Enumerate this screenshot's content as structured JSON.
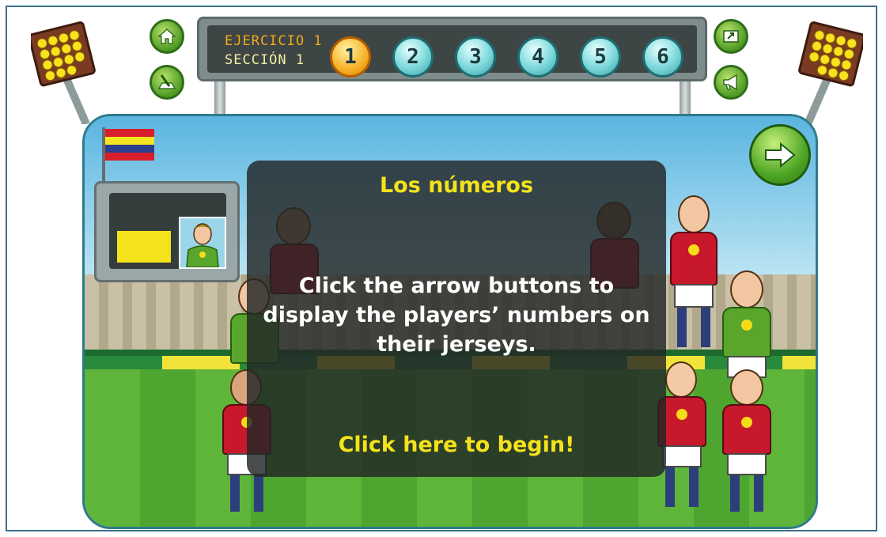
{
  "header": {
    "exercise_label": "EJERCICIO 1",
    "section_label": "SECCIÓN 1",
    "current_number": "1",
    "numbers": [
      "1",
      "2",
      "3",
      "4",
      "5",
      "6"
    ]
  },
  "icons": {
    "home": "home-icon",
    "pencil": "pencil-icon",
    "fullscreen": "fullscreen-icon",
    "sound": "megaphone-icon",
    "next": "arrow-right-icon"
  },
  "overlay": {
    "title": "Los números",
    "instructions": "Click the arrow buttons to display the players’ numbers on their jerseys.",
    "begin": "Click here to begin!"
  },
  "colors": {
    "accent_yellow": "#f4e21b",
    "scoreboard_orange": "#f3a91d",
    "border_blue": "#3d6e8c"
  }
}
